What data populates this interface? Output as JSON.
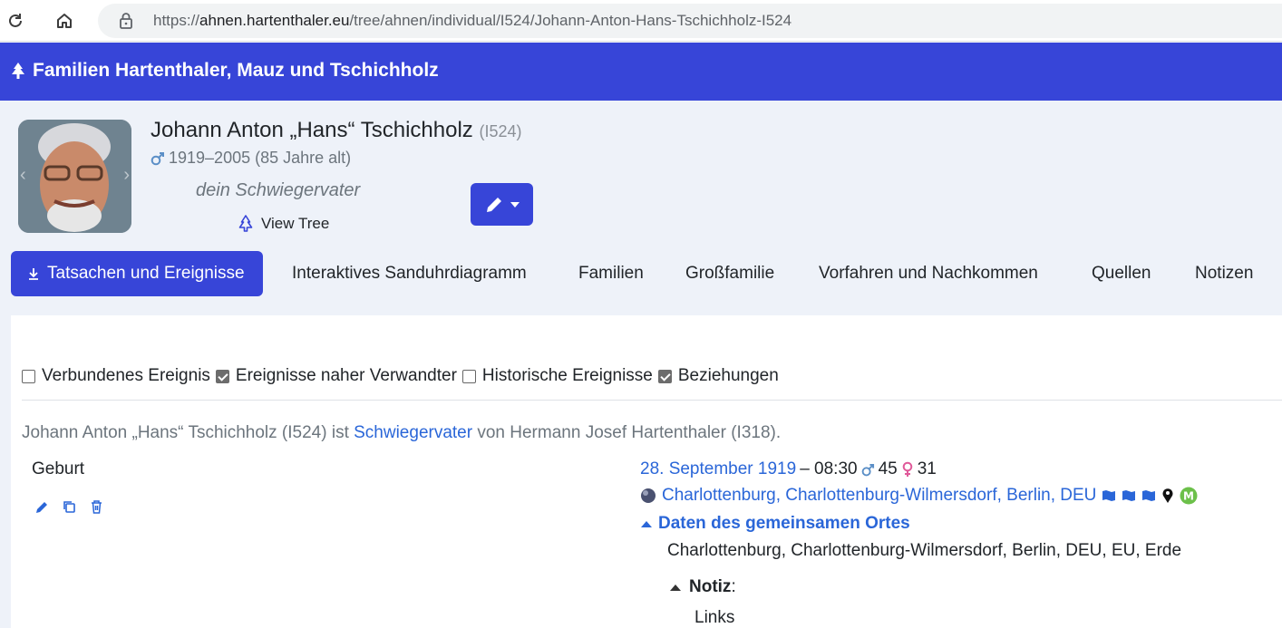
{
  "browser": {
    "url_prefix": "https://",
    "url_host": "ahnen.hartenthaler.eu",
    "url_path": "/tree/ahnen/individual/I524/Johann-Anton-Hans-Tschichholz-I524"
  },
  "site": {
    "title": "Familien Hartenthaler, Mauz und Tschichholz"
  },
  "individual": {
    "name": "Johann Anton „Hans“ Tschichholz",
    "xref": "(I524)",
    "lifespan": "1919–2005 (85 Jahre alt)",
    "relationship": "dein Schwiegervater",
    "view_tree": "View Tree"
  },
  "tabs": [
    {
      "label": "Tatsachen und Ereignisse"
    },
    {
      "label": "Interaktives Sanduhrdiagramm"
    },
    {
      "label": "Familien"
    },
    {
      "label": "Großfamilie"
    },
    {
      "label": "Vorfahren und Nachkommen"
    },
    {
      "label": "Quellen"
    },
    {
      "label": "Notizen"
    }
  ],
  "filters": [
    {
      "label": "Verbundenes Ereignis",
      "checked": false
    },
    {
      "label": "Ereignisse naher Verwandter",
      "checked": true
    },
    {
      "label": "Historische Ereignisse",
      "checked": false
    },
    {
      "label": "Beziehungen",
      "checked": true
    }
  ],
  "relation_sentence": {
    "before": "Johann Anton „Hans“ Tschichholz (I524) ist ",
    "link": "Schwiegervater",
    "after": " von Hermann Josef Hartenthaler (I318)."
  },
  "event": {
    "label": "Geburt",
    "date": "28. September 1919",
    "time": "– 08:30",
    "father_age": "45",
    "mother_age": "31",
    "place": "Charlottenburg, Charlottenburg-Wilmersdorf, Berlin, DEU",
    "shared_place_toggle": "Daten des gemeinsamen Ortes",
    "shared_place_value": "Charlottenburg, Charlottenburg-Wilmersdorf, Berlin, DEU, EU, Erde",
    "note_label": "Notiz",
    "note_suffix": ":",
    "note_links": "Links"
  },
  "colors": {
    "primary": "#3745d8",
    "link": "#2a66d8",
    "male": "#5b8fc7",
    "female": "#e05a9a"
  }
}
